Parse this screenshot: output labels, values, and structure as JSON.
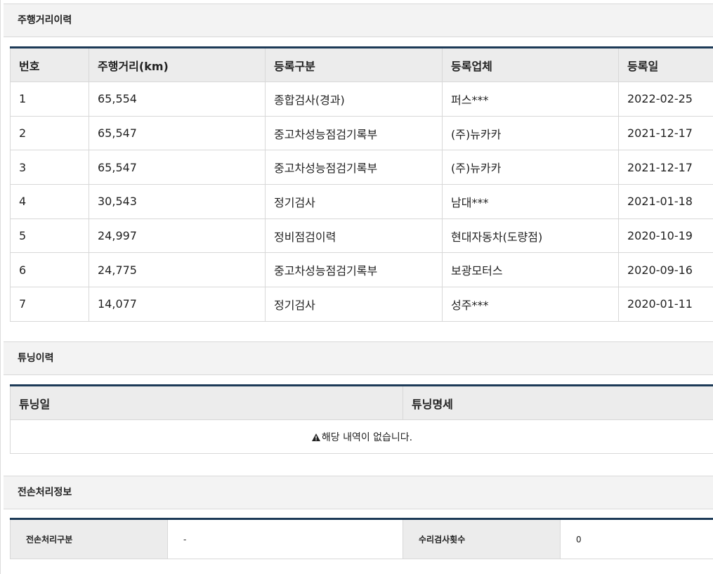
{
  "mileage": {
    "title": "주행거리이력",
    "headers": [
      "번호",
      "주행거리(km)",
      "등록구분",
      "등록업체",
      "등록일"
    ],
    "rows": [
      [
        "1",
        "65,554",
        "종합검사(경과)",
        "퍼스***",
        "2022-02-25"
      ],
      [
        "2",
        "65,547",
        "중고차성능점검기록부",
        "(주)뉴카카",
        "2021-12-17"
      ],
      [
        "3",
        "65,547",
        "중고차성능점검기록부",
        "(주)뉴카카",
        "2021-12-17"
      ],
      [
        "4",
        "30,543",
        "정기검사",
        "남대***",
        "2021-01-18"
      ],
      [
        "5",
        "24,997",
        "정비점검이력",
        "현대자동차(도량점)",
        "2020-10-19"
      ],
      [
        "6",
        "24,775",
        "중고차성능점검기록부",
        "보광모터스",
        "2020-09-16"
      ],
      [
        "7",
        "14,077",
        "정기검사",
        "성주***",
        "2020-01-11"
      ]
    ]
  },
  "tuning": {
    "title": "튜닝이력",
    "headers": [
      "튜닝일",
      "튜닝명세"
    ],
    "empty_message": "해당 내역이 없습니다."
  },
  "loss": {
    "title": "전손처리정보",
    "loss_type_label": "전손처리구분",
    "loss_type_value": "-",
    "repair_count_label": "수리검사횟수",
    "repair_count_value": "0"
  },
  "colors": {
    "table_top_border": "#1c3a57",
    "header_bg": "#ececec",
    "section_bg": "#f3f3f3"
  },
  "icons": {
    "empty_notice": "warning-icon"
  }
}
